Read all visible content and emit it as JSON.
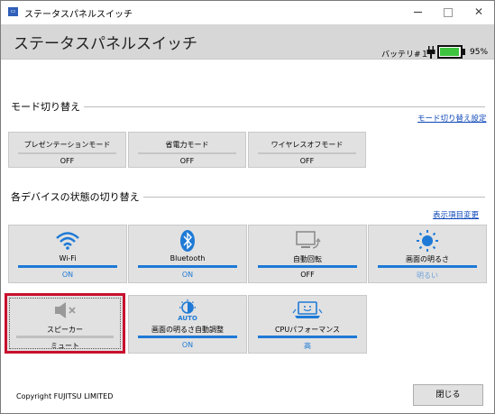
{
  "window": {
    "title": "ステータスパネルスイッチ",
    "header_title": "ステータスパネルスイッチ",
    "controls": [
      "–",
      "□",
      "✕"
    ]
  },
  "battery": {
    "label": "バッテリ#１",
    "percent_text": "95%",
    "level": 0.95,
    "fill_color": "#3ec43e"
  },
  "mode_section": {
    "title": "モード切り替え",
    "settings_link": "モード切り替え設定",
    "buttons": [
      {
        "label": "プレゼンテーションモード",
        "value": "OFF"
      },
      {
        "label": "省電力モード",
        "value": "OFF"
      },
      {
        "label": "ワイヤレスオフモード",
        "value": "OFF"
      }
    ]
  },
  "device_section": {
    "title": "各デバイスの状態の切り替え",
    "display_link": "表示項目変更",
    "tiles": [
      {
        "label": "Wi-Fi",
        "value": "ON",
        "icon": "wifi-icon"
      },
      {
        "label": "Bluetooth",
        "value": "ON",
        "icon": "bluetooth-icon"
      },
      {
        "label": "自動回転",
        "value": "OFF",
        "icon": "rotate-icon"
      },
      {
        "label": "画面の明るさ",
        "value": "明るい",
        "icon": "brightness-icon"
      },
      {
        "label": "スピーカー",
        "value": "ミュート",
        "icon": "speaker-mute-icon"
      },
      {
        "label": "画面の明るさ自動調整",
        "value": "ON",
        "icon": "auto-brightness-icon",
        "icon_text": "AUTO"
      },
      {
        "label": "CPUパフォーマンス",
        "value": "高",
        "icon": "cpu-performance-icon"
      }
    ]
  },
  "footer": {
    "copyright": "Copyright FUJITSU LIMITED",
    "close_label": "閉じる"
  },
  "colors": {
    "accent": "#1e7ad6",
    "selection": "#c8102e",
    "tile_bg": "#e1e1e1",
    "header_bg": "#d7d7d7",
    "link": "#0b46b8"
  }
}
